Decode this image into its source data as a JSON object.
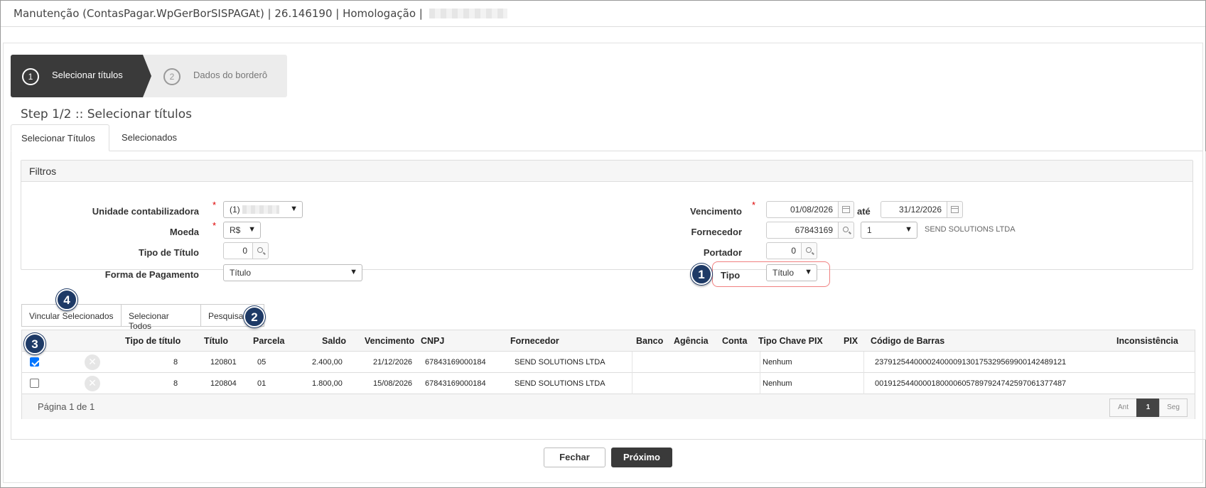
{
  "window": {
    "title": "Manutenção (ContasPagar.WpGerBorSISPAGAt) | 26.146190 | Homologação |"
  },
  "wizard": {
    "steps": [
      {
        "number": "1",
        "label": "Selecionar títulos"
      },
      {
        "number": "2",
        "label": "Dados do borderô"
      }
    ],
    "heading": "Step 1/2 :: Selecionar títulos"
  },
  "tabs": [
    "Selecionar Títulos",
    "Selecionados"
  ],
  "filters": {
    "title": "Filtros",
    "unidade_label": "Unidade contabilizadora",
    "unidade_value": "(1)",
    "moeda_label": "Moeda",
    "moeda_value": "R$",
    "tipo_titulo_label": "Tipo de Título",
    "tipo_titulo_value": "0",
    "forma_label": "Forma de Pagamento",
    "forma_value": "Título",
    "vencimento_label": "Vencimento",
    "vencimento_de": "01/08/2026",
    "ate_label": "até",
    "vencimento_ate": "31/12/2026",
    "fornecedor_label": "Fornecedor",
    "fornecedor_code": "67843169",
    "fornecedor_loja": "1",
    "fornecedor_name": "SEND SOLUTIONS LTDA",
    "portador_label": "Portador",
    "portador_value": "0",
    "tipo_label": "Tipo",
    "tipo_value": "Título"
  },
  "actions": {
    "vincular": "Vincular Selecionados",
    "selecionar_todos": "Selecionar Todos",
    "pesquisar": "Pesquisar"
  },
  "callouts": [
    "1",
    "2",
    "3",
    "4"
  ],
  "table": {
    "headers": [
      "Tipo de título",
      "Título",
      "Parcela",
      "Saldo",
      "Vencimento",
      "CNPJ",
      "Fornecedor",
      "Banco",
      "Agência",
      "Conta",
      "Tipo Chave PIX",
      "PIX",
      "Código de Barras",
      "Inconsistência"
    ],
    "rows": [
      {
        "checked": true,
        "tipo": "8",
        "titulo": "120801",
        "parcela": "05",
        "saldo": "2.400,00",
        "vencimento": "21/12/2026",
        "cnpj": "67843169000184",
        "fornecedor": "SEND SOLUTIONS LTDA",
        "banco": "",
        "agencia": "",
        "conta": "",
        "tipo_chave": "Nenhum",
        "pix": "",
        "codigo": "23791254400002400009130175329569900142489121",
        "inconsistencia": ""
      },
      {
        "checked": false,
        "tipo": "8",
        "titulo": "120804",
        "parcela": "01",
        "saldo": "1.800,00",
        "vencimento": "15/08/2026",
        "cnpj": "67843169000184",
        "fornecedor": "SEND SOLUTIONS LTDA",
        "banco": "",
        "agencia": "",
        "conta": "",
        "tipo_chave": "Nenhum",
        "pix": "",
        "codigo": "00191254400001800006057897924742597061377487",
        "inconsistencia": ""
      }
    ],
    "pagination_text": "Página 1 de 1",
    "pager": {
      "prev": "Ant",
      "current": "1",
      "next": "Seg"
    }
  },
  "footer": {
    "fechar": "Fechar",
    "proximo": "Próximo"
  },
  "colors": {
    "dark": "#3a3a3a",
    "callout": "#1e3a66",
    "highlight": "#f08080"
  }
}
